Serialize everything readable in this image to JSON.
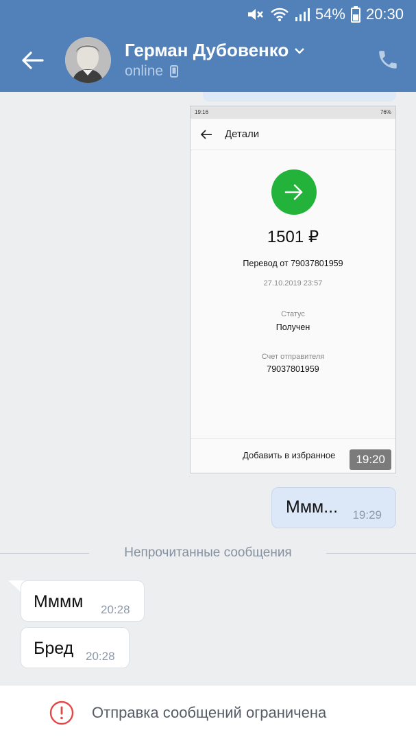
{
  "status_bar": {
    "battery_percent": "54%",
    "time": "20:30"
  },
  "header": {
    "contact_name": "Герман Дубовенко",
    "presence": "online",
    "colors": {
      "header_bg": "#5181b8",
      "presence": "#b8cde6"
    },
    "icons": [
      "arrow-left-icon",
      "chevron-down-icon",
      "mobile-device-icon",
      "phone-icon"
    ]
  },
  "messages": {
    "photo_message": {
      "time": "19:20",
      "screenshot": {
        "status_time": "19:16",
        "status_battery": "76%",
        "title": "Детали",
        "amount": "1501 ₽",
        "transfer_from": "Перевод от 79037801959",
        "datetime": "27.10.2019 23:57",
        "status_label": "Статус",
        "status_value": "Получен",
        "sender_account_label": "Счет отправителя",
        "sender_account_value": "79037801959",
        "add_to_favorites": "Добавить в избранное"
      }
    },
    "outgoing_1": {
      "text": "Ммм...",
      "time": "19:29"
    },
    "unread_divider": "Непрочитанные сообщения",
    "incoming_1": {
      "text": "Мммм",
      "time": "20:28"
    },
    "incoming_2": {
      "text": "Бред",
      "time": "20:28"
    }
  },
  "footer": {
    "restriction_text": "Отправка сообщений ограничена",
    "icon": "exclamation-circle-icon",
    "icon_color": "#e64646"
  }
}
